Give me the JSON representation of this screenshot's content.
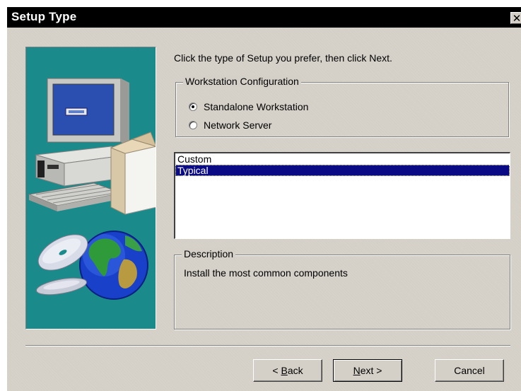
{
  "window": {
    "title": "Setup Type",
    "close_glyph": "✕"
  },
  "instruction": "Click the type of Setup you prefer, then click Next.",
  "workstation_group": {
    "legend": "Workstation Configuration",
    "options": [
      {
        "label": "Standalone Workstation",
        "selected": true
      },
      {
        "label": "Network Server",
        "selected": false
      }
    ]
  },
  "setup_list": {
    "items": [
      {
        "label": "Custom",
        "selected": false
      },
      {
        "label": "Typical",
        "selected": true
      }
    ]
  },
  "description": {
    "legend": "Description",
    "text": "Install the most common components"
  },
  "buttons": {
    "back": {
      "prefix": "< ",
      "accel": "B",
      "rest": "ack"
    },
    "next": {
      "accel": "N",
      "rest": "ext >"
    },
    "cancel": "Cancel"
  },
  "art": {
    "icons": [
      "computer-icon",
      "cd-disc-icon",
      "globe-icon"
    ],
    "background_color": "#1a8a8a"
  },
  "colors": {
    "titlebar": "#000000",
    "dialog_bg": "#d4d0c8",
    "selection": "#0a0a84"
  }
}
